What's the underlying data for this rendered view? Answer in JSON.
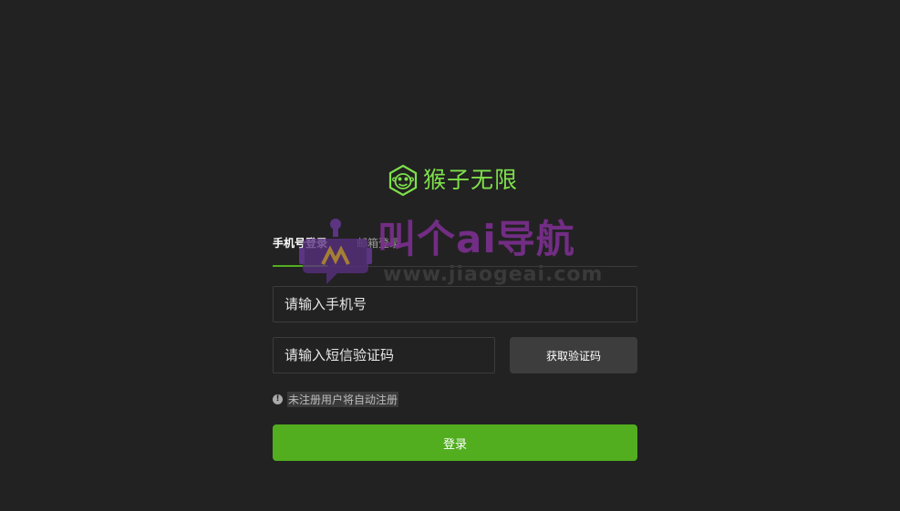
{
  "brand": {
    "name": "猴子无限",
    "icon": "monkey-face-hexagon-icon",
    "color": "#7ee04a"
  },
  "tabs": [
    {
      "label": "手机号登录",
      "active": true
    },
    {
      "label": "邮箱登录",
      "active": false
    }
  ],
  "form": {
    "phone_placeholder": "请输入手机号",
    "code_placeholder": "请输入短信验证码",
    "get_code_label": "获取验证码",
    "notice_icon": "info-icon",
    "notice_text": "未注册用户将自动注册",
    "login_label": "登录"
  },
  "watermark": {
    "title": "叫个ai导航",
    "url": "www.jiaogeai.com"
  },
  "colors": {
    "background": "#222222",
    "accent": "#52ae1f",
    "button_secondary": "#3d3d3d"
  }
}
